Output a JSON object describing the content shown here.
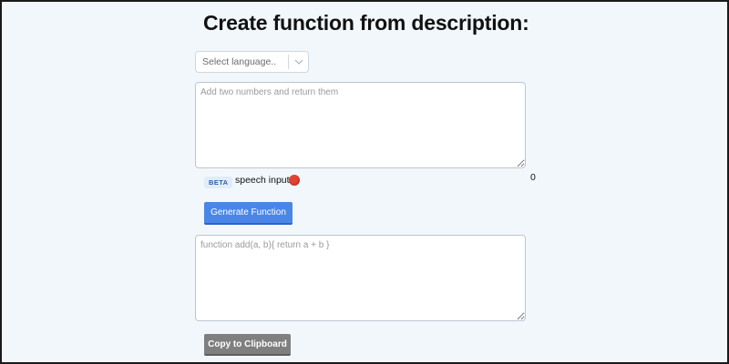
{
  "page": {
    "title": "Create function from description:"
  },
  "language_select": {
    "selected": "Select language.."
  },
  "description_input": {
    "placeholder": "Add two numbers and return them",
    "value": ""
  },
  "speech": {
    "badge": "BETA",
    "label": "speech input:",
    "indicator_color": "#e34234"
  },
  "counter": {
    "value": "0"
  },
  "buttons": {
    "generate": "Generate Function",
    "copy": "Copy to Clipboard"
  },
  "output": {
    "placeholder": "function add(a, b){ return a + b }",
    "value": ""
  },
  "colors": {
    "background": "#f2f7fc",
    "primary_button": "#4a86e8",
    "secondary_button": "#7f7f7f"
  },
  "icons": {
    "dropdown": "chevron-down-icon",
    "mic": "record-dot-icon"
  }
}
